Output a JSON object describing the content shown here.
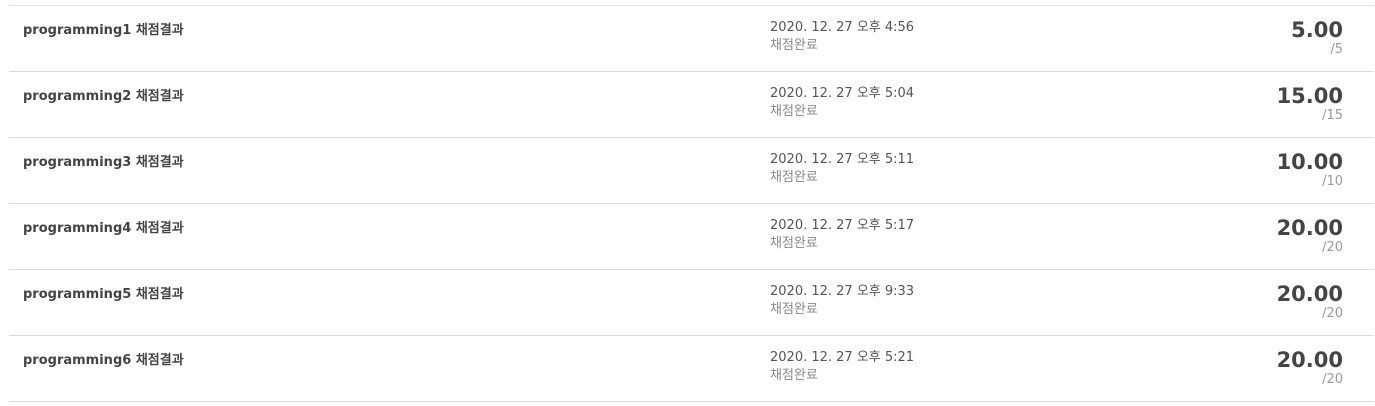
{
  "results": [
    {
      "title": "programming1 채점결과",
      "date": "2020. 12. 27 오후 4:56",
      "status": "채점완료",
      "score": "5.00",
      "max": "/5"
    },
    {
      "title": "programming2 채점결과",
      "date": "2020. 12. 27 오후 5:04",
      "status": "채점완료",
      "score": "15.00",
      "max": "/15"
    },
    {
      "title": "programming3 채점결과",
      "date": "2020. 12. 27 오후 5:11",
      "status": "채점완료",
      "score": "10.00",
      "max": "/10"
    },
    {
      "title": "programming4 채점결과",
      "date": "2020. 12. 27 오후 5:17",
      "status": "채점완료",
      "score": "20.00",
      "max": "/20"
    },
    {
      "title": "programming5 채점결과",
      "date": "2020. 12. 27 오후 9:33",
      "status": "채점완료",
      "score": "20.00",
      "max": "/20"
    },
    {
      "title": "programming6 채점결과",
      "date": "2020. 12. 27 오후 5:21",
      "status": "채점완료",
      "score": "20.00",
      "max": "/20"
    }
  ]
}
